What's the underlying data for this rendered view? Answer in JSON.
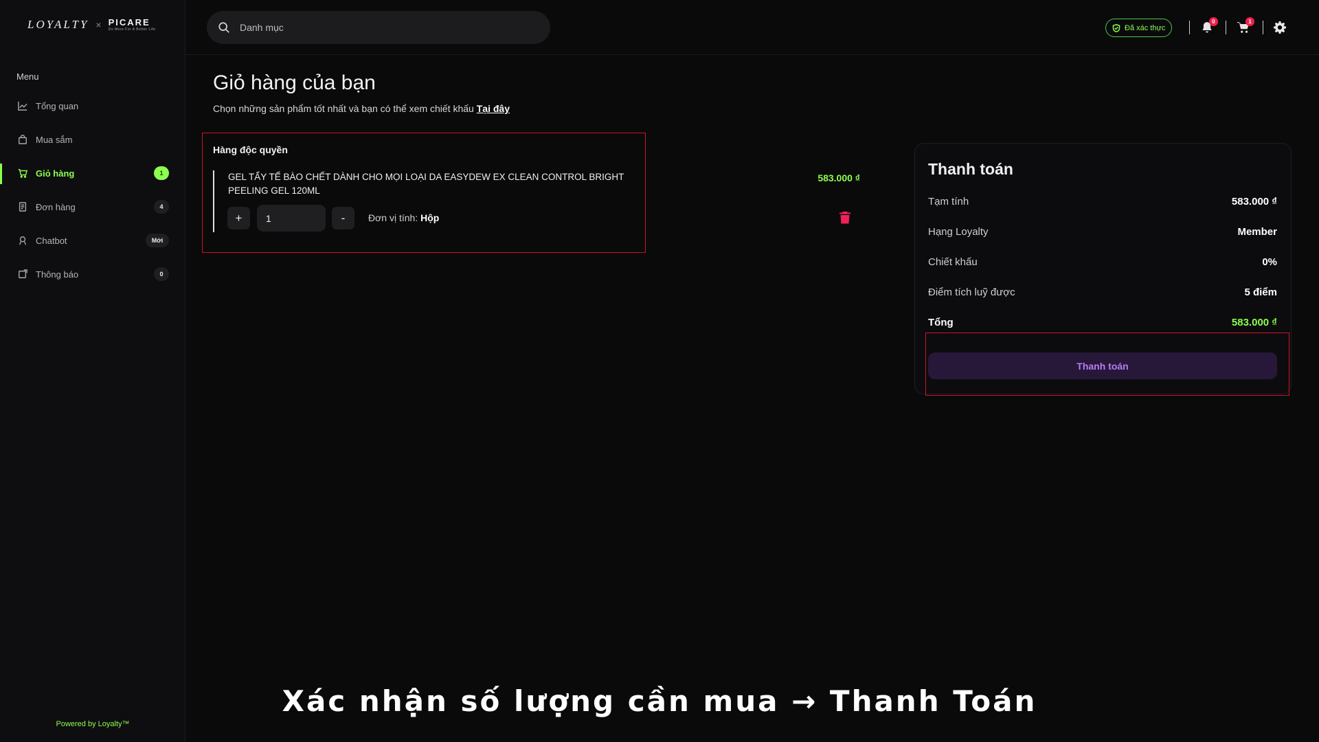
{
  "brand": {
    "logo_left": "LOYALTY",
    "logo_sep": "×",
    "logo_right": "PICARE",
    "logo_tagline": "Do More For A Better Life"
  },
  "sidebar": {
    "menu_title": "Menu",
    "items": [
      {
        "label": "Tổng quan",
        "icon": "chart-line-icon"
      },
      {
        "label": "Mua sắm",
        "icon": "shopping-bag-icon"
      },
      {
        "label": "Giỏ hàng",
        "icon": "cart-icon",
        "badge": "1",
        "active": true
      },
      {
        "label": "Đơn hàng",
        "icon": "document-icon",
        "badge": "4"
      },
      {
        "label": "Chatbot",
        "icon": "bot-icon",
        "badge": "Mới"
      },
      {
        "label": "Thông báo",
        "icon": "notification-icon",
        "badge": "0"
      }
    ],
    "powered_by": "Powered by Loyalty™"
  },
  "topbar": {
    "search_placeholder": "Danh mục",
    "verified_label": "Đã xác thực",
    "notifications_count": "0",
    "cart_count": "1"
  },
  "page": {
    "title": "Giỏ hàng của bạn",
    "subtitle": "Chọn những sản phẩm tốt nhất và bạn có thể xem chiết khấu",
    "subtitle_link": "Tại đây"
  },
  "cart": {
    "section_label": "Hàng độc quyền",
    "item": {
      "name": "GEL TẨY TẾ BÀO CHẾT DÀNH CHO MỌI LOẠI DA EASYDEW EX CLEAN CONTROL BRIGHT PEELING GEL 120ML",
      "price": "583.000 ₫",
      "plus_label": "+",
      "minus_label": "-",
      "quantity": "1",
      "unit_label": "Đơn vị tính:",
      "unit_value": "Hộp"
    }
  },
  "payment": {
    "title": "Thanh toán",
    "rows": [
      {
        "label": "Tạm tính",
        "value": "583.000 ₫"
      },
      {
        "label": "Hạng Loyalty",
        "value": "Member"
      },
      {
        "label": "Chiết khấu",
        "value": "0%"
      },
      {
        "label": "Điểm tích luỹ được",
        "value": "5 điểm"
      }
    ],
    "total_label": "Tổng",
    "total_value": "583.000 ₫",
    "button_label": "Thanh toán"
  },
  "caption": "Xác nhận số lượng cần mua → Thanh Toán",
  "colors": {
    "accent_green": "#8cff4e",
    "highlight_red": "#d01028",
    "pay_button_bg": "#27183a",
    "pay_button_text": "#b77cf2"
  }
}
